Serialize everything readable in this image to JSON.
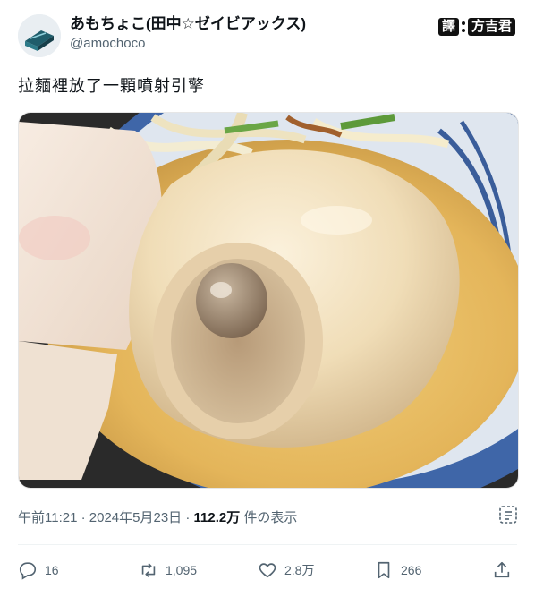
{
  "author": {
    "display_name": "あもちょこ(田中☆ゼイビアックス)",
    "handle": "@amochoco",
    "avatar_icon": "bird-logo-avatar"
  },
  "stamp": {
    "left": "譯",
    "right": "方吉君"
  },
  "tweet": {
    "text": "拉麵裡放了一顆噴射引擎"
  },
  "media": {
    "alt": "ramen egg resembling a jet engine"
  },
  "meta": {
    "time": "午前11:21",
    "date": "2024年5月23日",
    "separator": "·",
    "views_count": "112.2万",
    "views_label": "件の表示"
  },
  "actions": {
    "reply": {
      "icon": "reply-icon",
      "count": "16"
    },
    "retweet": {
      "icon": "retweet-icon",
      "count": "1,095"
    },
    "like": {
      "icon": "heart-icon",
      "count": "2.8万"
    },
    "bookmark": {
      "icon": "bookmark-icon",
      "count": "266"
    },
    "share": {
      "icon": "share-icon"
    }
  },
  "colors": {
    "text_primary": "#0f1419",
    "text_secondary": "#536471",
    "divider": "#eff3f4"
  }
}
